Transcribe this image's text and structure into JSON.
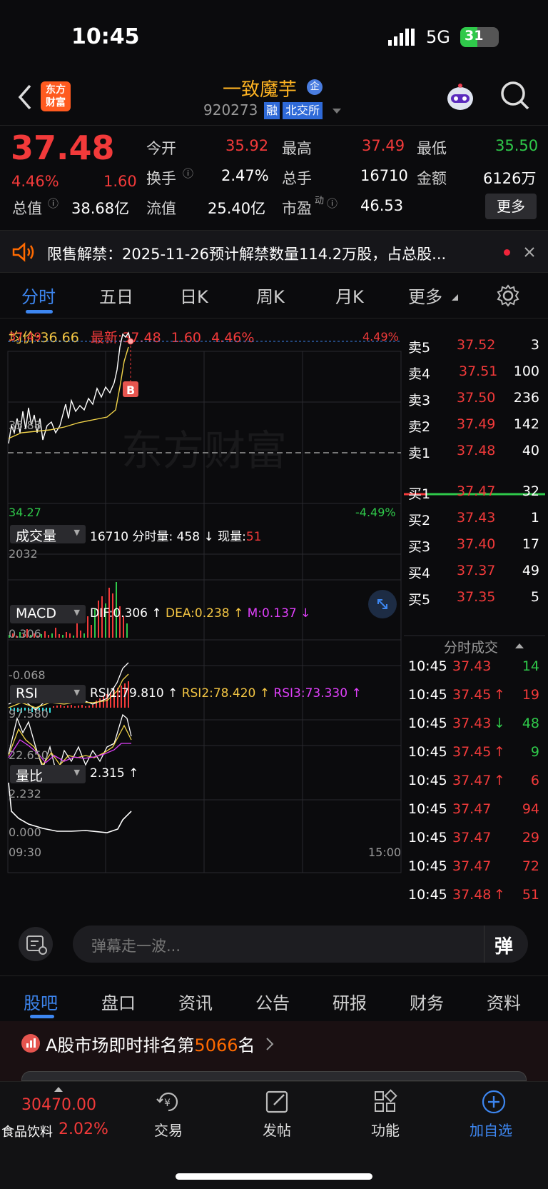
{
  "status_bar": {
    "time": "10:45",
    "network": "5G",
    "battery": "31"
  },
  "header": {
    "back_icon": "chevron-left-icon",
    "logo_text_line1": "东方",
    "logo_text_line2": "财富",
    "stock_name": "一致魔芋",
    "stock_badge": "企",
    "stock_code": "920273",
    "tag_margin": "融",
    "tag_exchange": "北交所"
  },
  "quote": {
    "price": "37.48",
    "change_pct": "4.46%",
    "change_amt": "1.60",
    "open_label": "今开",
    "open": "35.92",
    "high_label": "最高",
    "high": "37.49",
    "low_label": "最低",
    "low": "35.50",
    "turnover_label": "换手",
    "turnover": "2.47%",
    "volume_label": "总手",
    "volume": "16710",
    "amount_label": "金额",
    "amount": "6126万",
    "mktcap_label": "总值",
    "mktcap": "38.68亿",
    "float_label": "流值",
    "float": "25.40亿",
    "pe_label": "市盈",
    "pe_sup": "动",
    "pe": "46.53",
    "more_button": "更多"
  },
  "notice": {
    "text": "限售解禁：2025-11-26预计解禁数量114.2万股，占总股..."
  },
  "chart_tabs": [
    "分时",
    "五日",
    "日K",
    "周K",
    "月K",
    "更多"
  ],
  "chart_info": {
    "avg_label": "均价:",
    "avg": "36.66",
    "latest_label": "最新:",
    "latest": "37.48",
    "chg": "1.60",
    "chg_pct": "4.46%"
  },
  "chart_axis": {
    "top_price": "37.49",
    "mid_price": "35.88",
    "bottom_price": "34.27",
    "top_pct": "4.49%",
    "bottom_pct": "-4.49%",
    "start_time": "09:30",
    "end_time": "15:00",
    "watermark": "东方财富",
    "marker": "B"
  },
  "volume_panel": {
    "label": "成交量",
    "total": "16710",
    "text1": "分时量: 458 ↓",
    "text2_label": "现量:",
    "text2": "51",
    "max": "2032"
  },
  "macd_panel": {
    "label": "MACD",
    "dif": "DIF:0.306 ↑",
    "dea": "DEA:0.238 ↑",
    "m": "M:0.137 ↓",
    "top": "0.306",
    "bottom": "-0.068"
  },
  "rsi_panel": {
    "label": "RSI",
    "rsi1": "RSI1:79.810 ↑",
    "rsi2": "RSI2:78.420 ↑",
    "rsi3": "RSI3:73.330 ↑",
    "top": "97.580",
    "bottom": "22.650"
  },
  "vr_panel": {
    "label": "量比",
    "value": "2.315 ↑",
    "top": "2.232",
    "bottom": "0.000"
  },
  "order_book": {
    "asks": [
      {
        "label": "卖5",
        "price": "37.52",
        "qty": "3"
      },
      {
        "label": "卖4",
        "price": "37.51",
        "qty": "100"
      },
      {
        "label": "卖3",
        "price": "37.50",
        "qty": "236"
      },
      {
        "label": "卖2",
        "price": "37.49",
        "qty": "142"
      },
      {
        "label": "卖1",
        "price": "37.48",
        "qty": "40"
      }
    ],
    "bids": [
      {
        "label": "买1",
        "price": "37.47",
        "qty": "32"
      },
      {
        "label": "买2",
        "price": "37.43",
        "qty": "1"
      },
      {
        "label": "买3",
        "price": "37.40",
        "qty": "17"
      },
      {
        "label": "买4",
        "price": "37.37",
        "qty": "49"
      },
      {
        "label": "买5",
        "price": "37.35",
        "qty": "5"
      }
    ]
  },
  "trades": {
    "title": "分时成交",
    "rows": [
      {
        "time": "10:45",
        "price": "37.43",
        "arrow": "",
        "vol": "14",
        "vcolor": "green"
      },
      {
        "time": "10:45",
        "price": "37.45",
        "arrow": "↑",
        "vol": "19",
        "vcolor": "red"
      },
      {
        "time": "10:45",
        "price": "37.43",
        "arrow": "↓",
        "vol": "48",
        "vcolor": "green"
      },
      {
        "time": "10:45",
        "price": "37.45",
        "arrow": "↑",
        "vol": "9",
        "vcolor": "green"
      },
      {
        "time": "10:45",
        "price": "37.47",
        "arrow": "↑",
        "vol": "6",
        "vcolor": "red"
      },
      {
        "time": "10:45",
        "price": "37.47",
        "arrow": "",
        "vol": "94",
        "vcolor": "red"
      },
      {
        "time": "10:45",
        "price": "37.47",
        "arrow": "",
        "vol": "29",
        "vcolor": "red"
      },
      {
        "time": "10:45",
        "price": "37.47",
        "arrow": "",
        "vol": "72",
        "vcolor": "red"
      },
      {
        "time": "10:45",
        "price": "37.48",
        "arrow": "↑",
        "vol": "51",
        "vcolor": "red"
      }
    ]
  },
  "danmu": {
    "placeholder": "弹幕走一波...",
    "send_label": "弹"
  },
  "bottom_tabs": [
    "股吧",
    "盘口",
    "资讯",
    "公告",
    "研报",
    "财务",
    "资料"
  ],
  "rank": {
    "prefix": "A股市场即时排名第",
    "rank": "5066",
    "suffix": "名"
  },
  "bottom_bar": {
    "index_value": "30470.00",
    "index_name": "食品饮料",
    "index_chg": "2.02%",
    "items": [
      {
        "label": "交易",
        "icon": "trade-yen-icon"
      },
      {
        "label": "发帖",
        "icon": "edit-post-icon"
      },
      {
        "label": "功能",
        "icon": "grid-apps-icon"
      },
      {
        "label": "加自选",
        "icon": "add-circle-icon"
      }
    ]
  },
  "colors": {
    "up": "#f23a3a",
    "down": "#2fc94a",
    "accent": "#3d86f0",
    "brand": "#ff6a00"
  }
}
